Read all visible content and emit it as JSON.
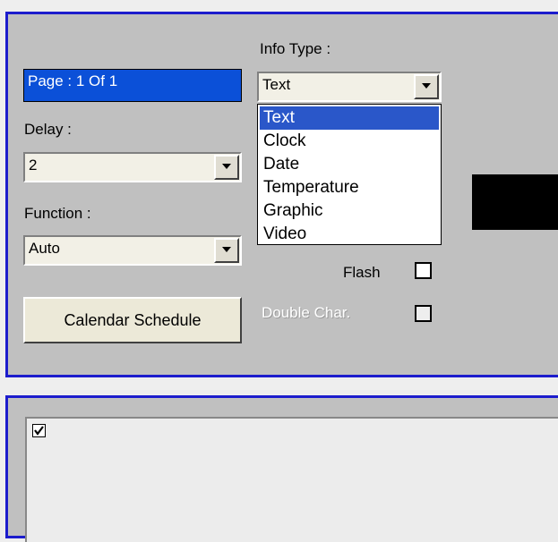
{
  "header": {
    "page_indicator": "Page : 1 Of 1",
    "delay_label": "Delay :",
    "function_label": "Function :",
    "info_type_label": "Info Type :"
  },
  "delay": {
    "value": "2"
  },
  "function": {
    "value": "Auto"
  },
  "info_type": {
    "value": "Text",
    "options": [
      "Text",
      "Clock",
      "Date",
      "Temperature",
      "Graphic",
      "Video"
    ],
    "selected_index": 0
  },
  "options": {
    "flash_label": "Flash",
    "flash_checked": false,
    "double_char_label": "Double Char.",
    "double_char_checked": false,
    "double_char_enabled": false
  },
  "buttons": {
    "calendar_schedule": "Calendar Schedule"
  },
  "bottom": {
    "row_checked": true
  },
  "colors": {
    "panel_border": "#1c1ccc",
    "panel_bg": "#c0c0c0",
    "highlight": "#0b50d8",
    "preview": "#000000"
  }
}
